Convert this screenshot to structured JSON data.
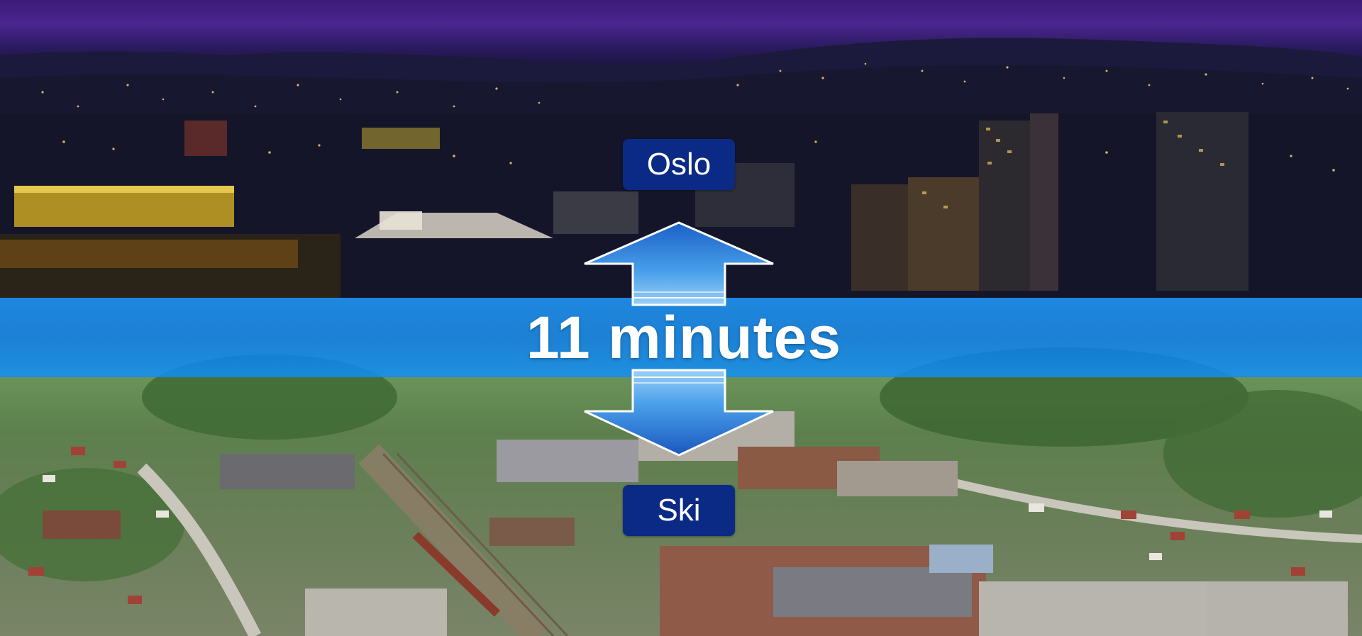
{
  "travel": {
    "origin": "Oslo",
    "destination": "Ski",
    "duration_label": "11 minutes"
  },
  "colors": {
    "label_background": "#0b2a86",
    "band": "#1a8ae6",
    "arrow": "#2f7fd8"
  },
  "icons": {
    "up": "arrow-up-icon",
    "down": "arrow-down-icon"
  }
}
